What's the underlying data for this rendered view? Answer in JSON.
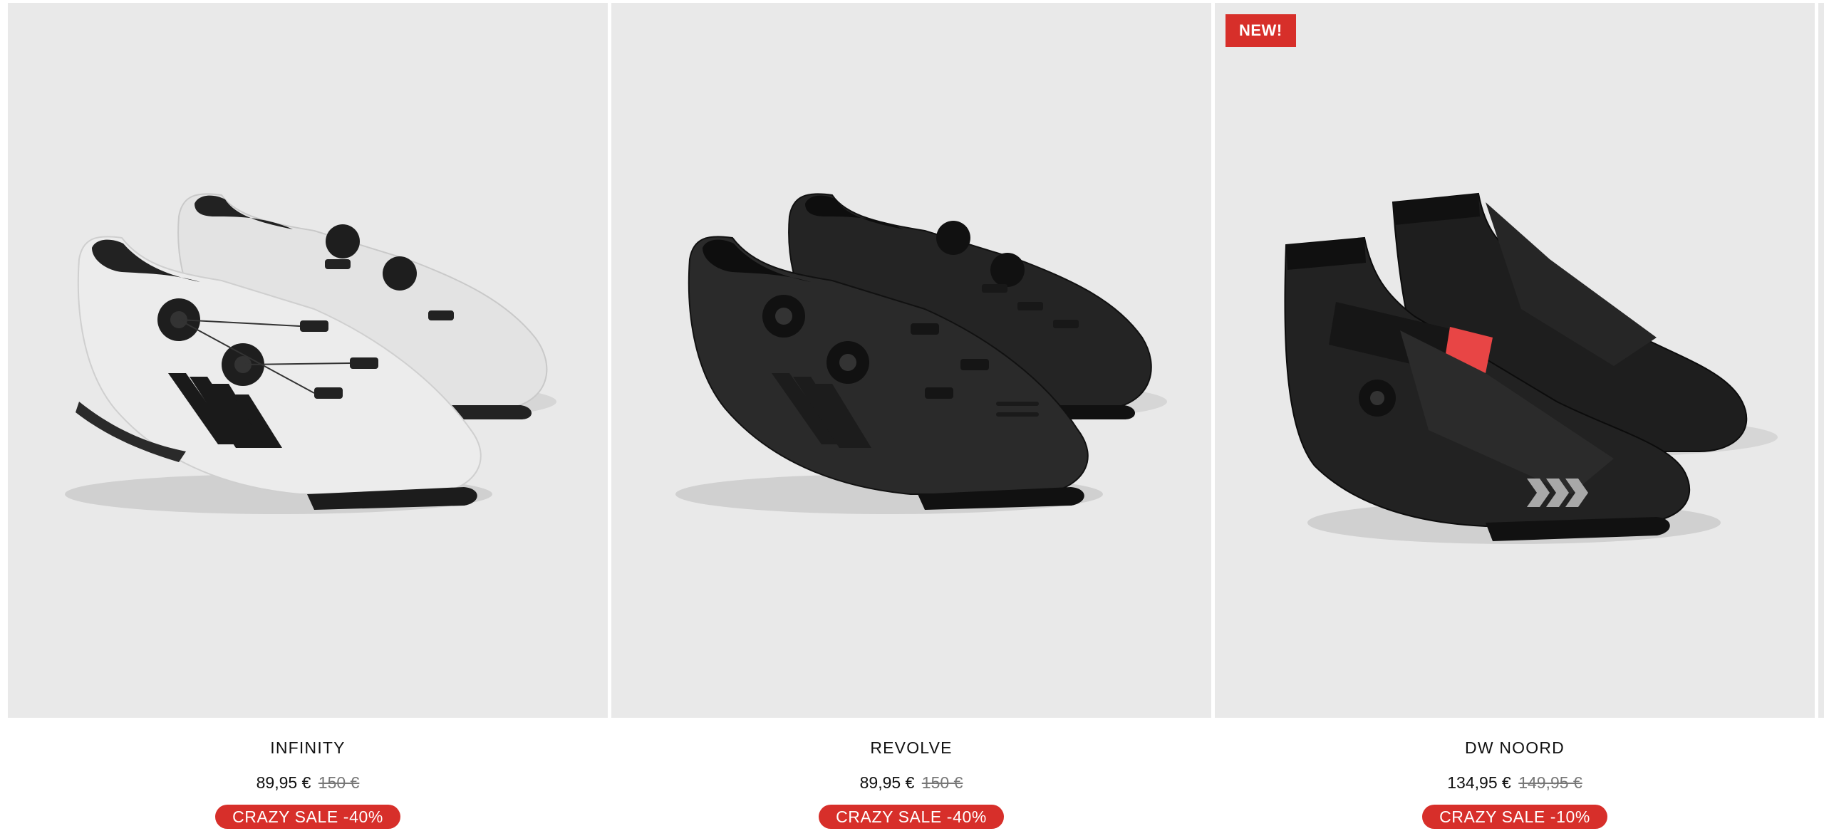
{
  "products": [
    {
      "title": "INFINITY",
      "price": "89,95 €",
      "old_price": "150 €",
      "sale_label": "CRAZY SALE -40%",
      "badge": "",
      "image_icon": "white-cycling-shoes-image"
    },
    {
      "title": "REVOLVE",
      "price": "89,95 €",
      "old_price": "150 €",
      "sale_label": "CRAZY SALE -40%",
      "badge": "",
      "image_icon": "black-cycling-shoes-image"
    },
    {
      "title": "DW NOORD",
      "price": "134,95 €",
      "old_price": "149,95 €",
      "sale_label": "CRAZY SALE -10%",
      "badge": "NEW!",
      "image_icon": "winter-cycling-boots-image"
    }
  ],
  "colors": {
    "accent": "#d72f2a",
    "image_background": "#e9e9e9"
  }
}
